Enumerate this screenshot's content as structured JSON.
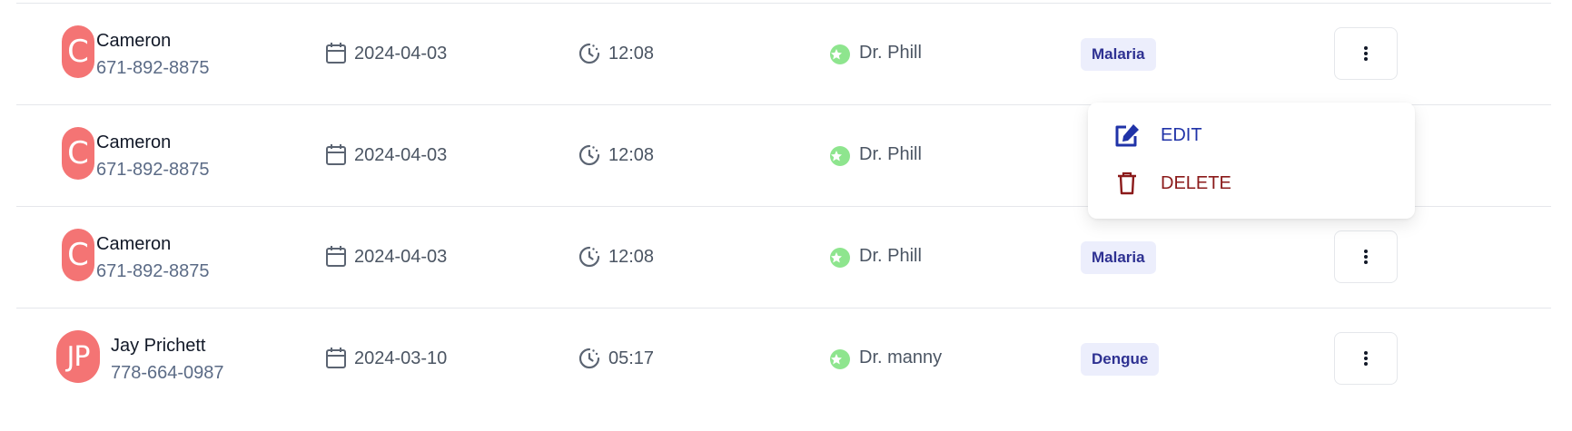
{
  "colors": {
    "avatar_bg": "#f47474",
    "tag_bg": "#eceefc",
    "tag_text": "#2e3192",
    "doctor_badge": "#8ee58e",
    "edit_text": "#2033a8",
    "delete_text": "#8b1a1a"
  },
  "rows": [
    {
      "initials": "C",
      "name": "Cameron",
      "phone": "671-892-8875",
      "date": "2024-04-03",
      "time": "12:08",
      "doctor": "Dr. Phill",
      "disease": "Malaria"
    },
    {
      "initials": "C",
      "name": "Cameron",
      "phone": "671-892-8875",
      "date": "2024-04-03",
      "time": "12:08",
      "doctor": "Dr. Phill",
      "disease": ""
    },
    {
      "initials": "C",
      "name": "Cameron",
      "phone": "671-892-8875",
      "date": "2024-04-03",
      "time": "12:08",
      "doctor": "Dr. Phill",
      "disease": "Malaria"
    },
    {
      "initials": "JP",
      "name": "Jay Prichett",
      "phone": "778-664-0987",
      "date": "2024-03-10",
      "time": "05:17",
      "doctor": "Dr. manny",
      "disease": "Dengue"
    }
  ],
  "menu": {
    "edit_label": "EDIT",
    "delete_label": "DELETE",
    "edit_icon": "edit-icon",
    "delete_icon": "trash-icon"
  },
  "icons": {
    "date": "calendar-icon",
    "time": "clock-icon",
    "doctor": "star-icon",
    "more": "more-vertical-icon"
  }
}
